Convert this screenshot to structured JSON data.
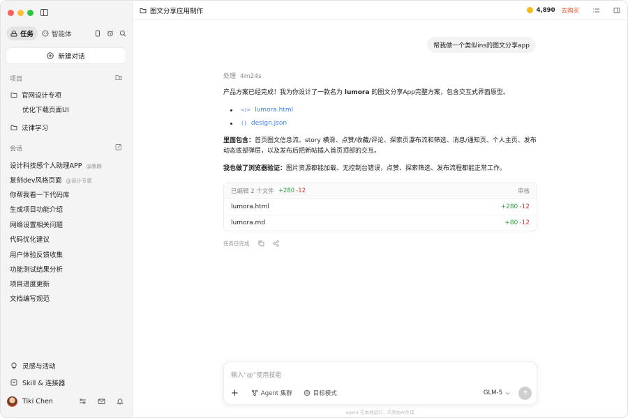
{
  "sidebar": {
    "tabs": [
      {
        "label": "任务"
      },
      {
        "label": "智能体"
      }
    ],
    "new_chat_label": "新建对话",
    "projects_title": "项目",
    "projects": [
      {
        "label": "官网设计专项",
        "children": [
          {
            "label": "优化下载页面UI"
          }
        ]
      },
      {
        "label": "法律学习"
      }
    ],
    "conversations_title": "会话",
    "conversations": [
      {
        "label": "设计科技感个人助理APP",
        "tag": "@豚豚"
      },
      {
        "label": "复刻dev风格页面",
        "tag": "@设计专家"
      },
      {
        "label": "你帮我看一下代码库"
      },
      {
        "label": "生成项目功能介绍"
      },
      {
        "label": "网络设置相关问题"
      },
      {
        "label": "代码优化建议"
      },
      {
        "label": "用户体验反馈收集"
      },
      {
        "label": "功能测试结果分析"
      },
      {
        "label": "项目进度更新"
      },
      {
        "label": "文档编写规范"
      }
    ],
    "bottom": [
      {
        "label": "灵感与活动"
      },
      {
        "label": "Skill & 连接器"
      }
    ],
    "user": {
      "name": "Tiki Chen"
    }
  },
  "header": {
    "title": "图文分享应用制作",
    "credits": "4,890",
    "buy_label": "去购买"
  },
  "chat": {
    "user_message": "帮我做一个类似ins的图文分享app",
    "processing_label": "处理",
    "processing_time": "4m24s",
    "intro_pre": "产品方案已经完成！我为你设计了一款名为 ",
    "intro_name": "lumora",
    "intro_post": " 的图文分享App完整方案，包含交互式界面原型。",
    "files": [
      {
        "name": "lumora.html"
      },
      {
        "name": "design.json"
      }
    ],
    "includes_label": "里面包含：",
    "includes_text": "首页图文信息流、story 横滑、点赞/收藏/评论、探索页瀑布流和筛选、消息/通知页、个人主页、发布动态底部弹层，以及发布后把新帖插入首页顶部的交互。",
    "verify_label": "我也做了浏览器验证：",
    "verify_text": "图片资源都能加载、无控制台错误，点赞、探索筛选、发布流程都能正常工作。",
    "edit_summary": {
      "label": "已编辑 2 个文件",
      "plus": "+280",
      "minus": "-12",
      "review_label": "审核",
      "files": [
        {
          "name": "lumora.html",
          "plus": "+280",
          "minus": "-12"
        },
        {
          "name": "lumora.md",
          "plus": "+80",
          "minus": "-12"
        }
      ]
    },
    "status_label": "任务已完成"
  },
  "composer": {
    "placeholder": "输入“@”使用技能",
    "agent_label": "Agent 集群",
    "goal_label": "目标模式",
    "model": "GLM-5"
  },
  "footer_note": "agent 在本地运行，内容由AI生成",
  "colors": {
    "accent_link": "#3b83f6",
    "plus": "#2f9e44",
    "minus": "#e03131",
    "buy": "#e8502c"
  }
}
